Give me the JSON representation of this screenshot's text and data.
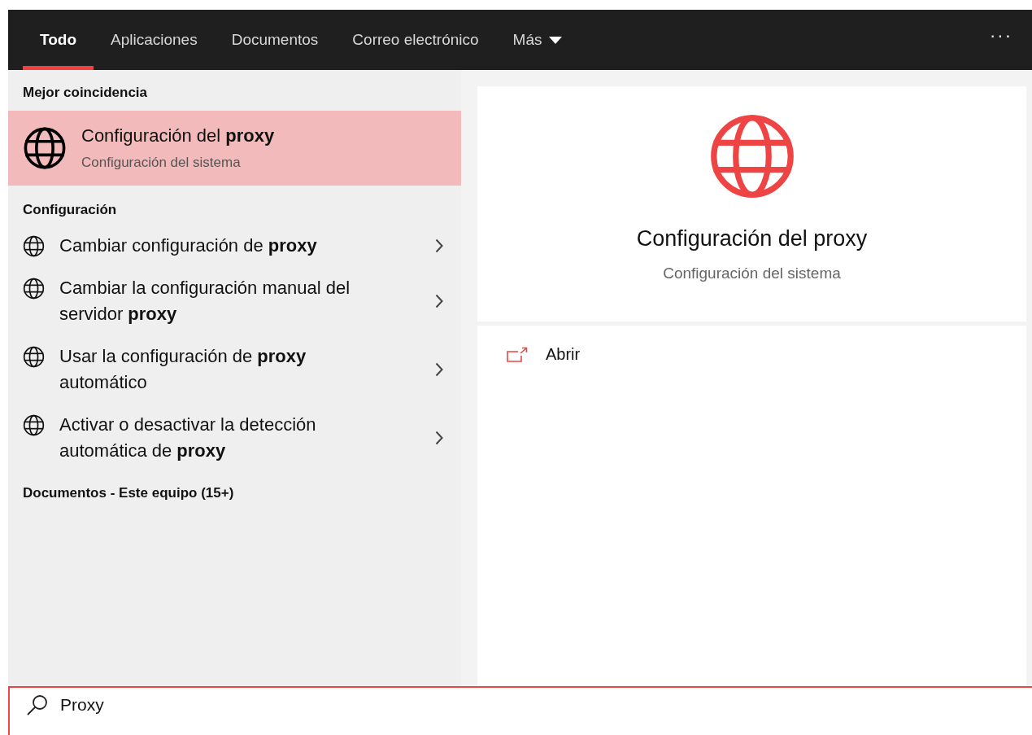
{
  "tabs": [
    {
      "label": "Todo",
      "selected": true
    },
    {
      "label": "Aplicaciones",
      "selected": false
    },
    {
      "label": "Documentos",
      "selected": false
    },
    {
      "label": "Correo electrónico",
      "selected": false
    },
    {
      "label": "Más",
      "selected": false,
      "kind": "dropdown"
    }
  ],
  "more_options": "···",
  "best_match": {
    "heading": "Mejor coincidencia",
    "title": "Configuración del **proxy**",
    "subtitle": "Configuración del sistema",
    "selected": true
  },
  "settings": {
    "heading": "Configuración",
    "items": [
      {
        "label": "Cambiar configuración de **proxy**"
      },
      {
        "label": "Cambiar la configuración manual del servidor **proxy**"
      },
      {
        "label": "Usar la configuración de **proxy** automático"
      },
      {
        "label": "Activar o desactivar la detección automática de **proxy**"
      }
    ]
  },
  "documents_heading": "Documentos - Este equipo (15+)",
  "preview": {
    "title": "Configuración del proxy",
    "subtitle": "Configuración del sistema",
    "actions": [
      {
        "label": "Abrir"
      }
    ]
  },
  "search": {
    "value": "Proxy"
  }
}
